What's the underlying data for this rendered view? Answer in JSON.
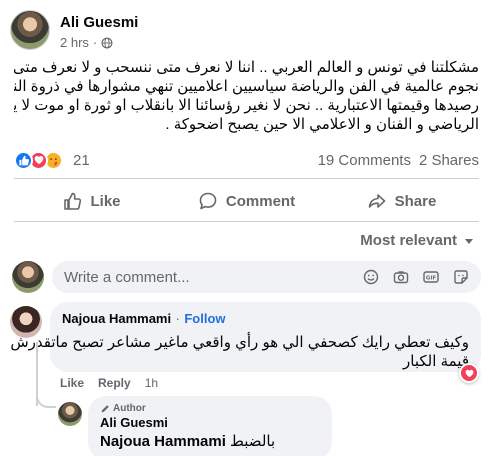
{
  "post": {
    "author": "Ali Guesmi",
    "time": "2 hrs",
    "text_lines": [
      "مشكلتنا في تونس و العالم العربي .. اننا لا نعرف متى ننسحب و لا نعرف متى يجب ان نتوقف ..",
      "نجوم عالمية في الفن والرياضة  سياسيين اعلاميين تنهي مشوارها في ذروة النجومية لتخلد",
      "رصيدها وقيمتها الاعتبارية .. نحن لا نغير رؤسائنا الا بانقلاب او ثورة او موت لا يتوقف",
      "الرياضي و الفنان و الاعلامي الا حين يصبح اضحوكة ."
    ]
  },
  "reactions": {
    "count": "21",
    "comments": "19 Comments",
    "shares": "2 Shares",
    "types": [
      "like-icon",
      "love-icon",
      "care-icon"
    ]
  },
  "actions": {
    "like": "Like",
    "comment": "Comment",
    "share": "Share"
  },
  "sort": {
    "label": "Most relevant"
  },
  "composer": {
    "placeholder": "Write a comment..."
  },
  "comments": [
    {
      "author": "Najoua Hammami",
      "follow": "Follow",
      "separator": "·",
      "text_lines": [
        "وكيف تعطي رايك كصحفي الي هو رأي واقعي ماغير مشاعر تصبح ماتقدرش",
        "قيمة الكبار"
      ],
      "like": "Like",
      "reply": "Reply",
      "time": "1h"
    }
  ],
  "reply": {
    "badge": "Author",
    "author": "Ali Guesmi",
    "mention": "Najoua Hammami",
    "text": "بالضبط"
  },
  "colors": {
    "link_blue": "#216fdb",
    "like_blue": "#1877f2",
    "love_red": "#f33e58",
    "secondary_text": "#65676b",
    "bubble_bg": "#f0f2f5"
  }
}
